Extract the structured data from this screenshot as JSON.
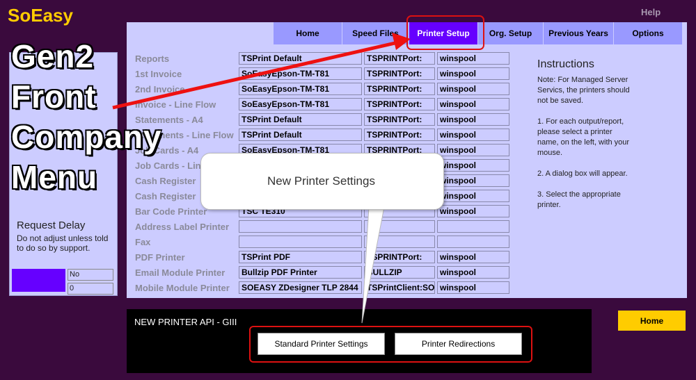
{
  "app": {
    "logo": "SoEasy",
    "help": "Help"
  },
  "tabs": [
    {
      "label": "Home",
      "active": false
    },
    {
      "label": "Speed Files",
      "active": false
    },
    {
      "label": "Printer Setup",
      "active": true
    },
    {
      "label": "Org. Setup",
      "active": false
    },
    {
      "label": "Previous Years",
      "active": false
    },
    {
      "label": "Options",
      "active": false
    }
  ],
  "printers": [
    {
      "label": "Reports",
      "name": "TSPrint Default",
      "port": "TSPRINTPort:",
      "driver": "winspool"
    },
    {
      "label": "1st Invoice",
      "name": "SoEasyEpson-TM-T81",
      "port": "TSPRINTPort:",
      "driver": "winspool"
    },
    {
      "label": "2nd Invoice",
      "name": "SoEasyEpson-TM-T81",
      "port": "TSPRINTPort:",
      "driver": "winspool"
    },
    {
      "label": "Invoice - Line Flow",
      "name": "SoEasyEpson-TM-T81",
      "port": "TSPRINTPort:",
      "driver": "winspool"
    },
    {
      "label": "Statements - A4",
      "name": "TSPrint Default",
      "port": "TSPRINTPort:",
      "driver": "winspool"
    },
    {
      "label": "Statements - Line Flow",
      "name": "TSPrint Default",
      "port": "TSPRINTPort:",
      "driver": "winspool"
    },
    {
      "label": "Job Cards - A4",
      "name": "SoEasyEpson-TM-T81",
      "port": "TSPRINTPort:",
      "driver": "winspool"
    },
    {
      "label": "Job Cards - Line Flow",
      "name": "",
      "port": "",
      "driver": "winspool"
    },
    {
      "label": "Cash Register",
      "name": "",
      "port": "",
      "driver": "winspool"
    },
    {
      "label": "Cash Register",
      "name": "",
      "port": "",
      "driver": "winspool"
    },
    {
      "label": "Bar Code Printer",
      "name": "TSC TE310",
      "port": "",
      "driver": "winspool"
    },
    {
      "label": "Address Label Printer",
      "name": "",
      "port": "",
      "driver": ""
    },
    {
      "label": "Fax",
      "name": "",
      "port": "",
      "driver": ""
    },
    {
      "label": "PDF Printer",
      "name": "TSPrint PDF",
      "port": "TSPRINTPort:",
      "driver": "winspool"
    },
    {
      "label": "Email Module Printer",
      "name": "Bullzip PDF Printer",
      "port": "BULLZIP",
      "driver": "winspool"
    },
    {
      "label": "Mobile Module Printer",
      "name": "SOEASY ZDesigner TLP 2844",
      "port": "TSPrintClient:SOE",
      "driver": "winspool"
    }
  ],
  "instructions": {
    "title": "Instructions",
    "p1": "Note: For Managed Server Servics, the printers should not be saved.",
    "p2": "1. For each output/report, please select a printer name, on the left,  with your mouse.",
    "p3": "2. A dialog box will appear.",
    "p4": "3. Select the appropriate printer."
  },
  "request_delay": {
    "title": "Request Delay",
    "text": "Do not adjust unless told to do so by support.",
    "value1": "No",
    "value2": "0"
  },
  "overlay": {
    "line1": "Gen2",
    "line2": "Front",
    "line3": "Company",
    "line4": "Menu"
  },
  "callout": {
    "text": "New Printer Settings"
  },
  "api": {
    "title": "NEW PRINTER API - GIII",
    "btn_standard": "Standard Printer Settings",
    "btn_redirect": "Printer Redirections"
  },
  "home_button": "Home",
  "colors": {
    "background": "#3a0a3d",
    "panel": "#ccccff",
    "tab": "#9999ff",
    "active_tab": "#6600ff",
    "accent": "#ffcc00",
    "annotation": "#dd1111"
  }
}
